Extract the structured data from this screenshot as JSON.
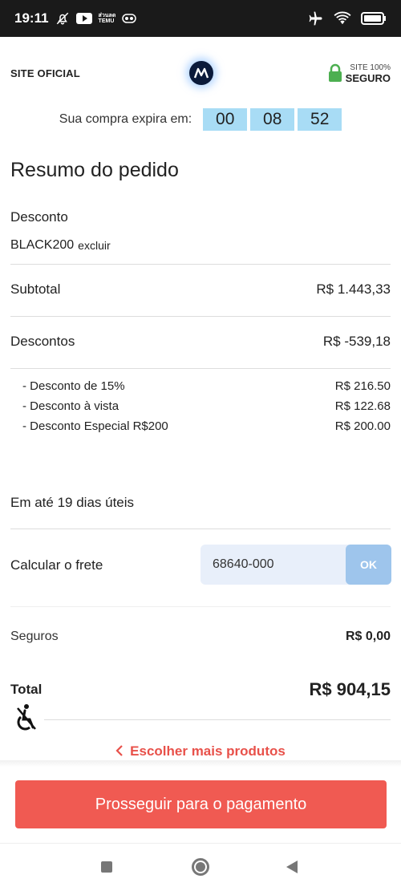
{
  "status_bar": {
    "time": "19:11",
    "icons_left": [
      "bell-off-icon",
      "youtube-icon",
      "temu-icon",
      "app-icon"
    ],
    "icons_right": [
      "airplane-icon",
      "wifi-icon",
      "battery-icon"
    ],
    "mini_label_1": "ส่วนลด",
    "mini_label_2": "TEMU"
  },
  "header": {
    "site_oficial": "SITE OFICIAL",
    "seguro_small": "SITE 100%",
    "seguro_big": "SEGURO"
  },
  "timer": {
    "label": "Sua compra expira em:",
    "hours": "00",
    "minutes": "08",
    "seconds": "52"
  },
  "summary": {
    "title": "Resumo do pedido",
    "discount_label": "Desconto",
    "coupon_code": "BLACK200",
    "coupon_remove": "excluir",
    "subtotal_label": "Subtotal",
    "subtotal_value": "R$ 1.443,33",
    "discounts_label": "Descontos",
    "discounts_value": "R$ -539,18",
    "discount_items": [
      {
        "label": "- Desconto de 15%",
        "value": "R$ 216.50"
      },
      {
        "label": "- Desconto à vista",
        "value": "R$ 122.68"
      },
      {
        "label": "- Desconto Especial R$200",
        "value": "R$ 200.00"
      }
    ],
    "delivery_text": "Em até 19 dias úteis",
    "shipping_label": "Calcular o frete",
    "cep_value": "68640-000",
    "ok_label": "OK",
    "insurance_label": "Seguros",
    "insurance_value": "R$ 0,00",
    "total_label": "Total",
    "total_value": "R$ 904,15"
  },
  "actions": {
    "back_link": "Escolher mais produtos",
    "pay_button": "Prosseguir para o pagamento"
  },
  "colors": {
    "timer_box": "#a8dcf5",
    "accent": "#f05a52",
    "ok_button": "#9ec5ec",
    "lock": "#4caf50"
  }
}
